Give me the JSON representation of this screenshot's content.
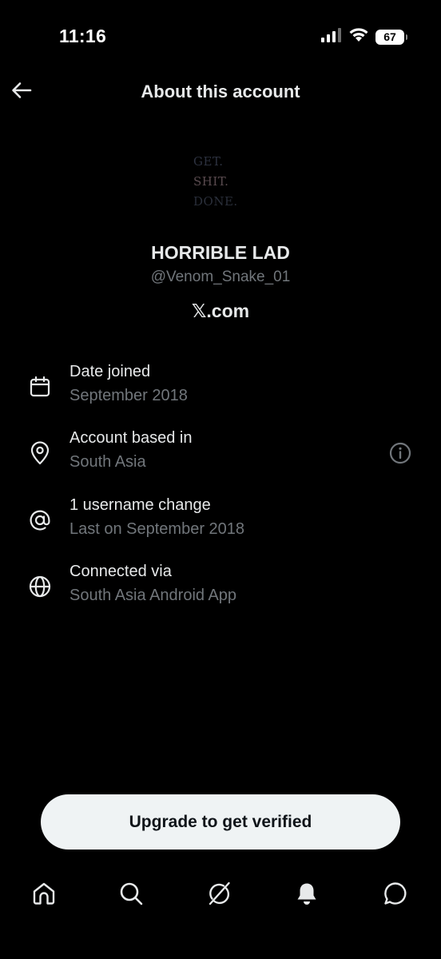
{
  "status_bar": {
    "time": "11:16",
    "battery": "67",
    "icons": [
      "signal-icon",
      "wifi-icon",
      "battery-icon"
    ]
  },
  "header": {
    "title": "About this account",
    "back_icon": "arrow-left-icon"
  },
  "profile": {
    "avatar_lines": [
      "GET.",
      "SHIT.",
      "DONE."
    ],
    "display_name": "HORRIBLE LAD",
    "handle": "@Venom_Snake_01",
    "site": "𝕏.com"
  },
  "details": [
    {
      "icon": "calendar-icon",
      "label": "Date joined",
      "value": "September 2018"
    },
    {
      "icon": "location-pin-icon",
      "label": "Account based in",
      "value": "South Asia",
      "help_icon": "info-icon"
    },
    {
      "icon": "at-sign-icon",
      "label": "1 username change",
      "value": "Last on September 2018"
    },
    {
      "icon": "globe-icon",
      "label": "Connected via",
      "value": "South Asia Android App"
    }
  ],
  "upgrade": {
    "label": "Upgrade to get verified"
  },
  "tabs": [
    "home-icon",
    "search-icon",
    "grok-icon",
    "notifications-bell-icon",
    "messages-icon"
  ],
  "colors": {
    "background": "#000000",
    "primary_text": "#e7e9ea",
    "secondary_text": "#71767b",
    "button_bg": "#eff3f4",
    "button_text": "#0f1419"
  }
}
